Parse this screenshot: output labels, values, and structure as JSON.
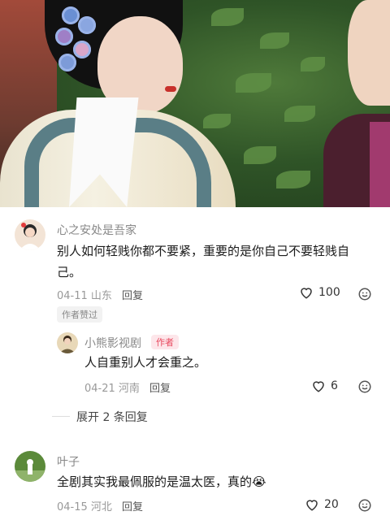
{
  "video": {
    "description_icon": "video-frame"
  },
  "comments": [
    {
      "username": "心之安处是吾家",
      "text": "别人如何轻贱你都不要紧，重要的是你自己不要轻贱自己。",
      "text_line1": "别人如何轻贱你都不要紧，重要的是你自己不要轻贱自",
      "text_line2": "己。",
      "date": "04-11",
      "location": "山东",
      "reply_label": "回复",
      "likes": "100",
      "badge": "作者赞过"
    },
    {
      "username": "小熊影视剧",
      "author_tag": "作者",
      "text": "人自重别人才会重之。",
      "date": "04-21",
      "location": "河南",
      "reply_label": "回复",
      "likes": "6"
    },
    {
      "username": "叶子",
      "text": "全剧其实我最佩服的是温太医，真的",
      "emoji": "😭",
      "date": "04-15",
      "location": "河北",
      "reply_label": "回复",
      "likes": "20"
    }
  ],
  "expand_replies": "展开 2 条回复",
  "colors": {
    "author_tag": "#e84a5f",
    "muted": "#999999"
  }
}
